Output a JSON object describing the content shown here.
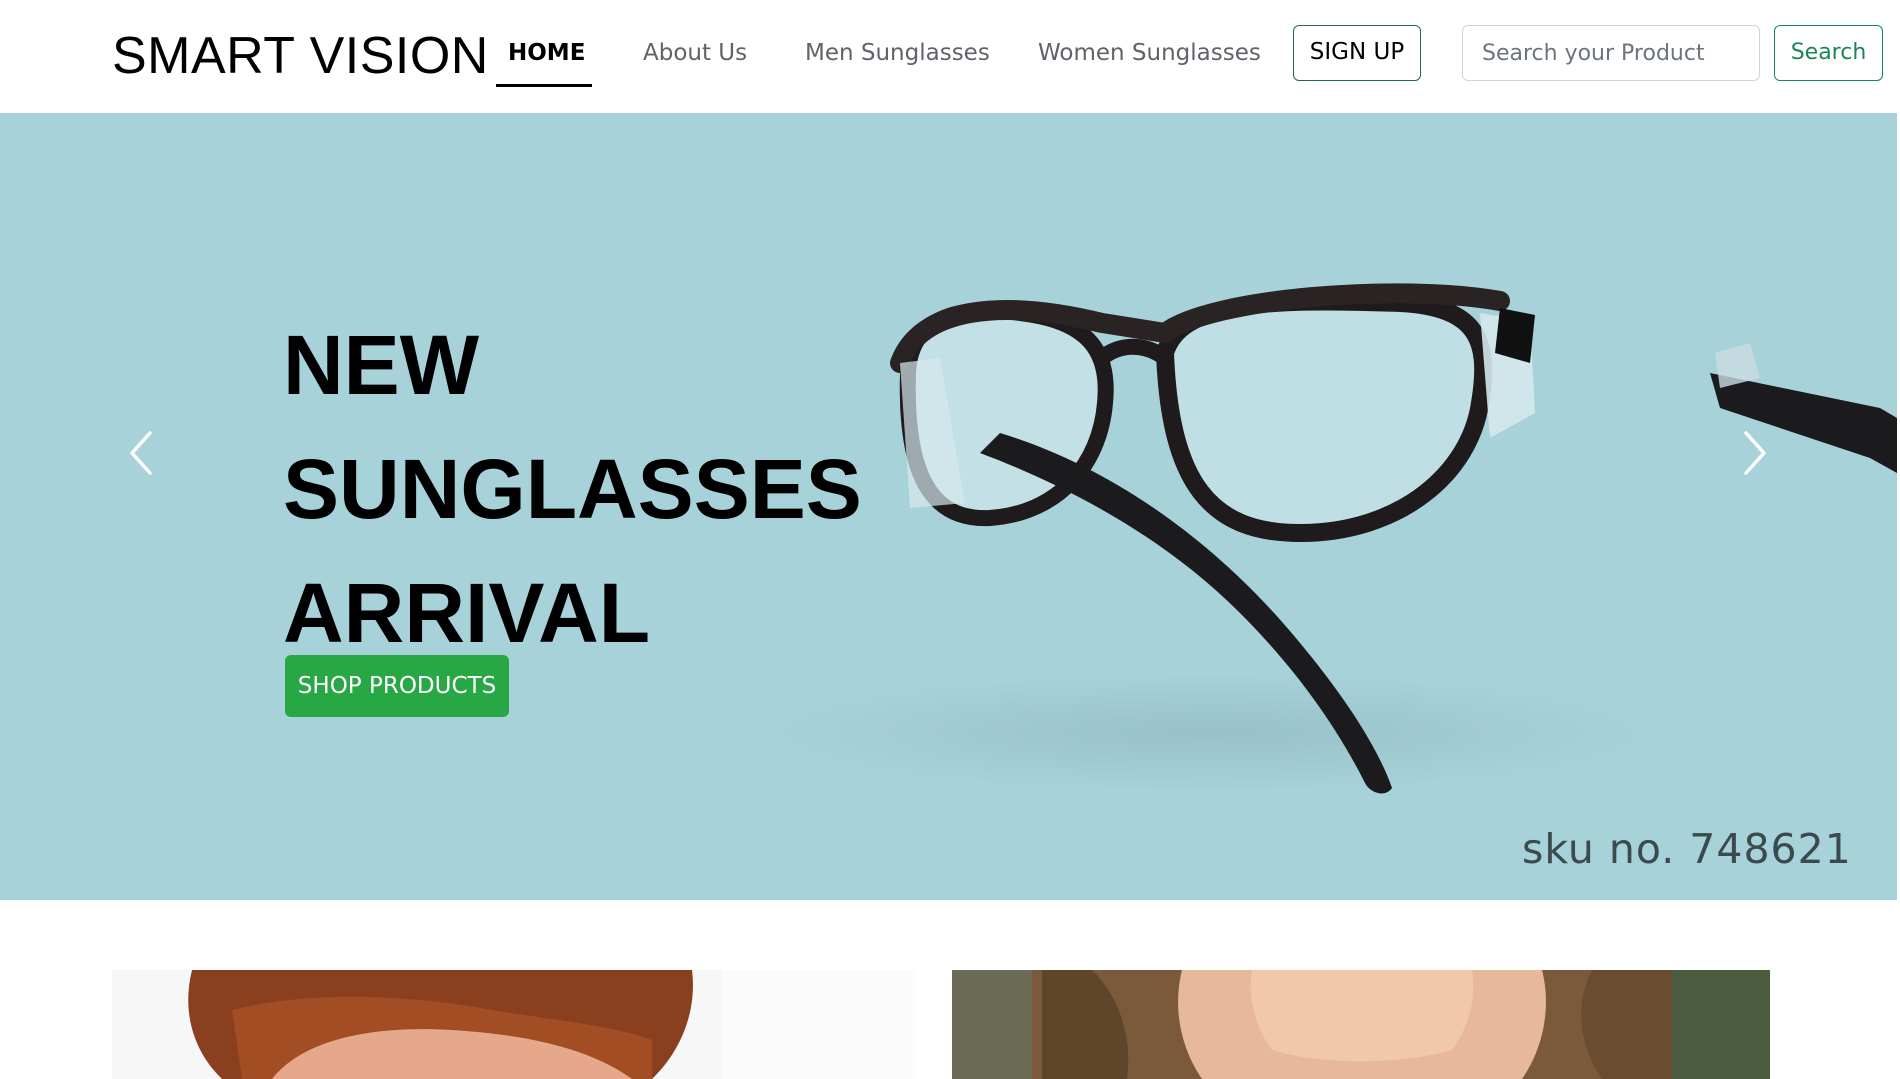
{
  "brand": {
    "name": "SMART VISION"
  },
  "nav": {
    "items": [
      {
        "label": "HOME",
        "active": true
      },
      {
        "label": "About Us"
      },
      {
        "label": "Men Sunglasses"
      },
      {
        "label": "Women Sunglasses"
      }
    ],
    "signup_label": "SIGN UP",
    "search_placeholder": "Search your Product",
    "search_label": "Search"
  },
  "hero": {
    "title_lines": [
      "NEW",
      "SUNGLASSES",
      "ARRIVAL"
    ],
    "cta_label": "SHOP PRODUCTS",
    "sku_text": "sku no. 748621",
    "prev_icon": "chevron-left-icon",
    "next_icon": "chevron-right-icon"
  },
  "colors": {
    "hero_background": "#a8d2d9",
    "cta_green": "#28a745",
    "search_green": "#198754",
    "signup_border": "#1e6b4f"
  },
  "products": [
    {
      "image": "man-portrait"
    },
    {
      "image": "woman-portrait"
    }
  ]
}
